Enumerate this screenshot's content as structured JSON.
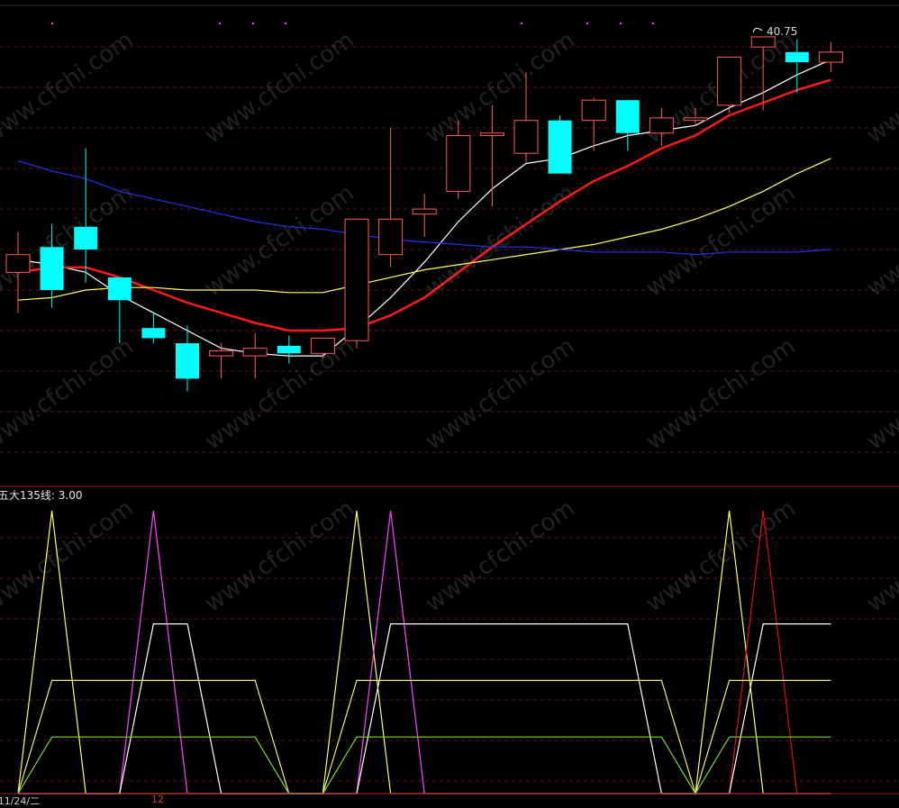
{
  "chart_data": [
    {
      "type": "candlestick",
      "title": "",
      "price_label": "40.75",
      "ylim": [
        23.5,
        42
      ],
      "candles": [
        {
          "o": 31.6,
          "h": 33.2,
          "l": 30.0,
          "c": 32.3
        },
        {
          "o": 32.6,
          "h": 33.5,
          "l": 30.2,
          "c": 30.9
        },
        {
          "o": 33.4,
          "h": 36.5,
          "l": 31.2,
          "c": 32.5
        },
        {
          "o": 31.4,
          "h": 31.4,
          "l": 28.8,
          "c": 30.5
        },
        {
          "o": 29.4,
          "h": 30.0,
          "l": 28.8,
          "c": 29.0
        },
        {
          "o": 28.8,
          "h": 29.5,
          "l": 26.9,
          "c": 27.4
        },
        {
          "o": 28.3,
          "h": 28.8,
          "l": 27.4,
          "c": 28.5
        },
        {
          "o": 28.3,
          "h": 29.2,
          "l": 27.4,
          "c": 28.6
        },
        {
          "o": 28.7,
          "h": 29.1,
          "l": 28.0,
          "c": 28.4
        },
        {
          "o": 28.4,
          "h": 29.0,
          "l": 28.2,
          "c": 29.0
        },
        {
          "o": 28.9,
          "h": 32.4,
          "l": 28.6,
          "c": 33.7
        },
        {
          "o": 32.3,
          "h": 37.3,
          "l": 31.8,
          "c": 33.7
        },
        {
          "o": 33.9,
          "h": 34.7,
          "l": 33.0,
          "c": 34.1
        },
        {
          "o": 34.8,
          "h": 37.6,
          "l": 34.5,
          "c": 37.0
        },
        {
          "o": 37.0,
          "h": 38.2,
          "l": 34.2,
          "c": 37.1
        },
        {
          "o": 36.3,
          "h": 39.5,
          "l": 35.9,
          "c": 37.6
        },
        {
          "o": 37.6,
          "h": 37.8,
          "l": 35.5,
          "c": 35.5
        },
        {
          "o": 37.6,
          "h": 38.5,
          "l": 36.4,
          "c": 38.4
        },
        {
          "o": 38.4,
          "h": 38.4,
          "l": 36.4,
          "c": 37.1
        },
        {
          "o": 37.1,
          "h": 38.1,
          "l": 36.6,
          "c": 37.7
        },
        {
          "o": 37.6,
          "h": 38.1,
          "l": 37.4,
          "c": 37.7
        },
        {
          "o": 38.2,
          "h": 40.1,
          "l": 37.9,
          "c": 40.1
        },
        {
          "o": 40.5,
          "h": 40.9,
          "l": 38.0,
          "c": 40.9
        },
        {
          "o": 40.3,
          "h": 40.8,
          "l": 38.7,
          "c": 39.9
        },
        {
          "o": 39.9,
          "h": 40.7,
          "l": 39.5,
          "c": 40.3
        }
      ],
      "series": [
        {
          "color": "#ffffff",
          "values": [
            32.1,
            31.9,
            31.6,
            30.7,
            30.0,
            29.3,
            28.6,
            28.4,
            28.3,
            28.3,
            29.4,
            30.6,
            32.0,
            33.6,
            34.9,
            35.9,
            36.1,
            36.6,
            37.0,
            37.2,
            37.4,
            38.1,
            38.7,
            39.4,
            40.0
          ]
        },
        {
          "color": "#ff1a1a",
          "values": [
            31.6,
            31.8,
            31.8,
            31.4,
            30.9,
            30.4,
            30.0,
            29.6,
            29.3,
            29.3,
            29.4,
            29.9,
            30.6,
            31.6,
            32.6,
            33.5,
            34.4,
            35.2,
            35.8,
            36.5,
            37.0,
            37.8,
            38.3,
            38.8,
            39.2
          ]
        },
        {
          "color": "#ffff66",
          "values": [
            30.5,
            30.6,
            30.9,
            31.0,
            31.0,
            30.9,
            30.9,
            30.9,
            30.8,
            30.8,
            31.1,
            31.4,
            31.7,
            31.9,
            32.1,
            32.3,
            32.5,
            32.7,
            33.0,
            33.3,
            33.7,
            34.2,
            34.8,
            35.5,
            36.1
          ]
        },
        {
          "color": "#2233ee",
          "values": [
            36.0,
            35.6,
            35.3,
            34.8,
            34.5,
            34.2,
            33.9,
            33.6,
            33.4,
            33.3,
            33.1,
            32.9,
            32.8,
            32.7,
            32.6,
            32.6,
            32.5,
            32.4,
            32.4,
            32.4,
            32.3,
            32.4,
            32.4,
            32.4,
            32.5
          ]
        }
      ]
    },
    {
      "type": "line",
      "title": "五大135线: 3.00",
      "ylim": [
        0,
        5
      ],
      "series": [
        {
          "color": "#ffff66",
          "values": [
            0,
            5,
            0,
            0,
            0,
            0,
            0,
            0,
            0,
            0,
            5,
            0,
            0,
            0,
            0,
            0,
            0,
            0,
            0,
            0,
            0,
            5,
            0,
            0,
            0
          ]
        },
        {
          "color": "#ff44ff",
          "values": [
            0,
            0,
            0,
            0,
            5,
            0,
            0,
            0,
            0,
            0,
            0,
            5,
            0,
            0,
            0,
            0,
            0,
            0,
            0,
            0,
            0,
            0,
            0,
            0,
            0
          ]
        },
        {
          "color": "#dd1111",
          "values": [
            0,
            0,
            0,
            0,
            0,
            0,
            0,
            0,
            0,
            0,
            0,
            0,
            0,
            0,
            0,
            0,
            0,
            0,
            0,
            0,
            0,
            0,
            5,
            0,
            0
          ]
        },
        {
          "color": "#ffffff",
          "values": [
            0,
            0,
            0,
            0,
            3,
            3,
            0,
            0,
            0,
            0,
            0,
            3,
            3,
            3,
            3,
            3,
            3,
            3,
            3,
            0,
            0,
            0,
            3,
            3,
            3
          ]
        },
        {
          "color": "#f0ee7a",
          "values": [
            0,
            2,
            2,
            2,
            2,
            2,
            2,
            2,
            0,
            0,
            2,
            2,
            2,
            2,
            2,
            2,
            2,
            2,
            2,
            2,
            0,
            2,
            2,
            2,
            2
          ]
        },
        {
          "color": "#77dd33",
          "values": [
            0,
            1,
            1,
            1,
            1,
            1,
            1,
            1,
            0,
            0,
            1,
            1,
            1,
            1,
            1,
            1,
            1,
            1,
            1,
            1,
            0,
            1,
            1,
            1,
            1
          ]
        }
      ]
    }
  ],
  "watermark": "www.cfchi.com",
  "bottom": {
    "date_label": "/11/24/二",
    "date_label2": "12"
  },
  "colors": {
    "up": "#ff5b5b",
    "down": "#00ffff",
    "grid": "#5a1414"
  }
}
